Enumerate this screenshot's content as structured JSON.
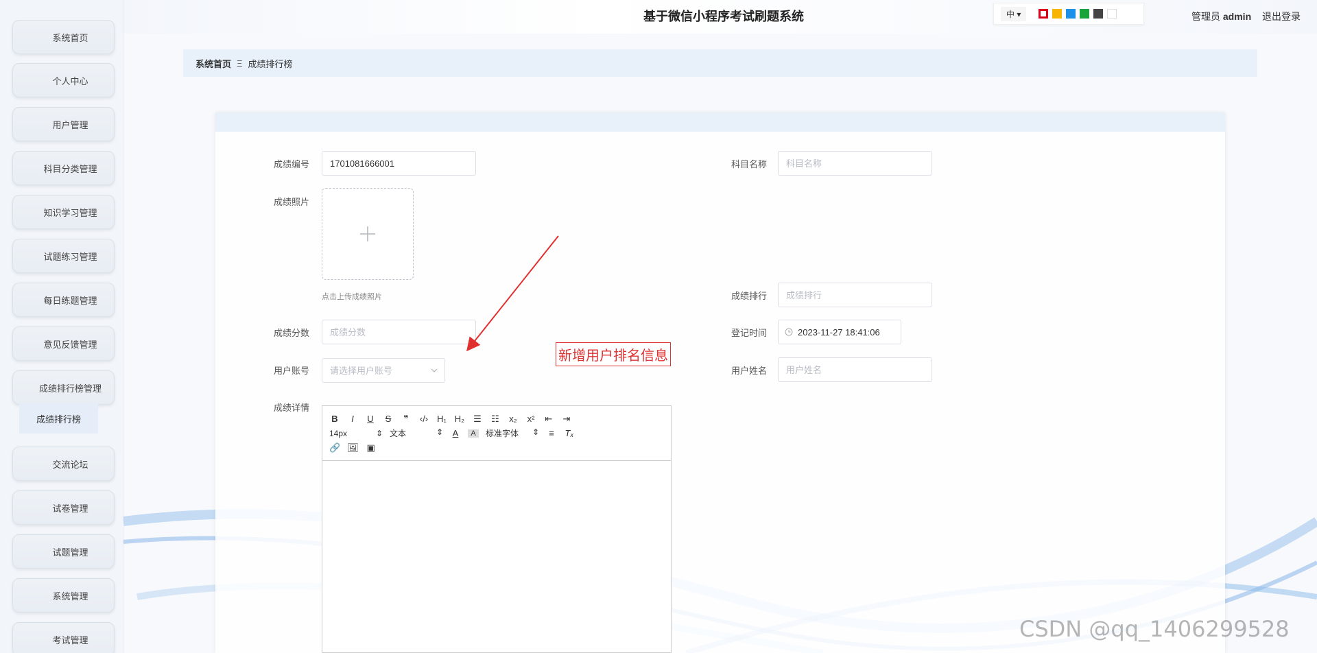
{
  "header": {
    "title": "基于微信小程序考试刷题系统",
    "lang": "中",
    "user_role": "管理员",
    "user_name": "admin",
    "logout": "退出登录",
    "swatches": [
      "#d9001b",
      "#f7b500",
      "#1e90e8",
      "#19a33a",
      "#444444",
      "#ffffff"
    ]
  },
  "sidebar": {
    "items": [
      {
        "label": "系统首页"
      },
      {
        "label": "个人中心"
      },
      {
        "label": "用户管理"
      },
      {
        "label": "科目分类管理"
      },
      {
        "label": "知识学习管理"
      },
      {
        "label": "试题练习管理"
      },
      {
        "label": "每日练题管理"
      },
      {
        "label": "意见反馈管理"
      },
      {
        "label": "成绩排行榜管理"
      },
      {
        "label": "交流论坛"
      },
      {
        "label": "试卷管理"
      },
      {
        "label": "试题管理"
      },
      {
        "label": "系统管理"
      },
      {
        "label": "考试管理"
      }
    ],
    "sub_item": "成绩排行榜"
  },
  "breadcrumb": {
    "home": "系统首页",
    "sep": "Ξ",
    "current": "成绩排行榜"
  },
  "form": {
    "score_no": {
      "label": "成绩编号",
      "value": "1701081666001"
    },
    "subject": {
      "label": "科目名称",
      "placeholder": "科目名称"
    },
    "photo": {
      "label": "成绩照片",
      "hint": "点击上传成绩照片"
    },
    "rank": {
      "label": "成绩排行",
      "placeholder": "成绩排行"
    },
    "score": {
      "label": "成绩分数",
      "placeholder": "成绩分数"
    },
    "reg_time": {
      "label": "登记时间",
      "value": "2023-11-27 18:41:06"
    },
    "account": {
      "label": "用户账号",
      "placeholder": "请选择用户账号"
    },
    "user_name": {
      "label": "用户姓名",
      "placeholder": "用户姓名"
    },
    "detail": {
      "label": "成绩详情"
    }
  },
  "editor": {
    "row1": [
      "B",
      "I",
      "U",
      "S",
      "❞",
      "‹/›",
      "H₁",
      "H₂",
      "☰",
      "☷",
      "x₂",
      "x²",
      "⇤",
      "⇥"
    ],
    "font_size": "14px",
    "block": "文本",
    "font": "标准字体",
    "row3": [
      "🔗",
      "🖼",
      "▣"
    ]
  },
  "annotation": "新增用户排名信息",
  "watermark": "CSDN @qq_1406299528"
}
